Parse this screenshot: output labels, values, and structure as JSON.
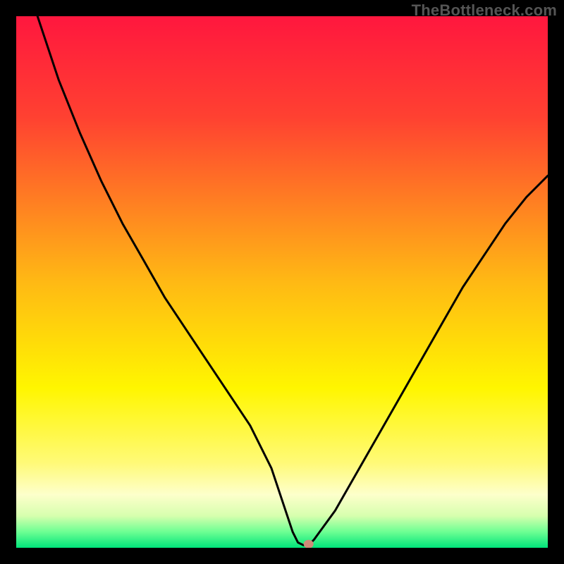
{
  "watermark": "TheBottleneck.com",
  "chart_data": {
    "type": "line",
    "title": "",
    "xlabel": "",
    "ylabel": "",
    "xlim": [
      0,
      100
    ],
    "ylim": [
      0,
      100
    ],
    "grid": false,
    "legend": false,
    "series": [
      {
        "name": "bottleneck-curve",
        "x": [
          0,
          4,
          8,
          12,
          16,
          20,
          24,
          28,
          32,
          36,
          40,
          44,
          48,
          50,
          52,
          53,
          54,
          55,
          56,
          60,
          64,
          68,
          72,
          76,
          80,
          84,
          88,
          92,
          96,
          100
        ],
        "y": [
          118,
          100,
          88,
          78,
          69,
          61,
          54,
          47,
          41,
          35,
          29,
          23,
          15,
          9,
          3,
          1,
          0.5,
          0.5,
          1.5,
          7,
          14,
          21,
          28,
          35,
          42,
          49,
          55,
          61,
          66,
          70
        ]
      }
    ],
    "marker": {
      "x": 55,
      "y": 0.7
    },
    "background_gradient": {
      "stops": [
        {
          "offset": 0.0,
          "color": "#ff173e"
        },
        {
          "offset": 0.19,
          "color": "#ff4131"
        },
        {
          "offset": 0.5,
          "color": "#ffb914"
        },
        {
          "offset": 0.7,
          "color": "#fff600"
        },
        {
          "offset": 0.84,
          "color": "#fffa77"
        },
        {
          "offset": 0.9,
          "color": "#fdffcb"
        },
        {
          "offset": 0.94,
          "color": "#d7ffae"
        },
        {
          "offset": 0.97,
          "color": "#6dff93"
        },
        {
          "offset": 1.0,
          "color": "#00e47a"
        }
      ]
    }
  }
}
